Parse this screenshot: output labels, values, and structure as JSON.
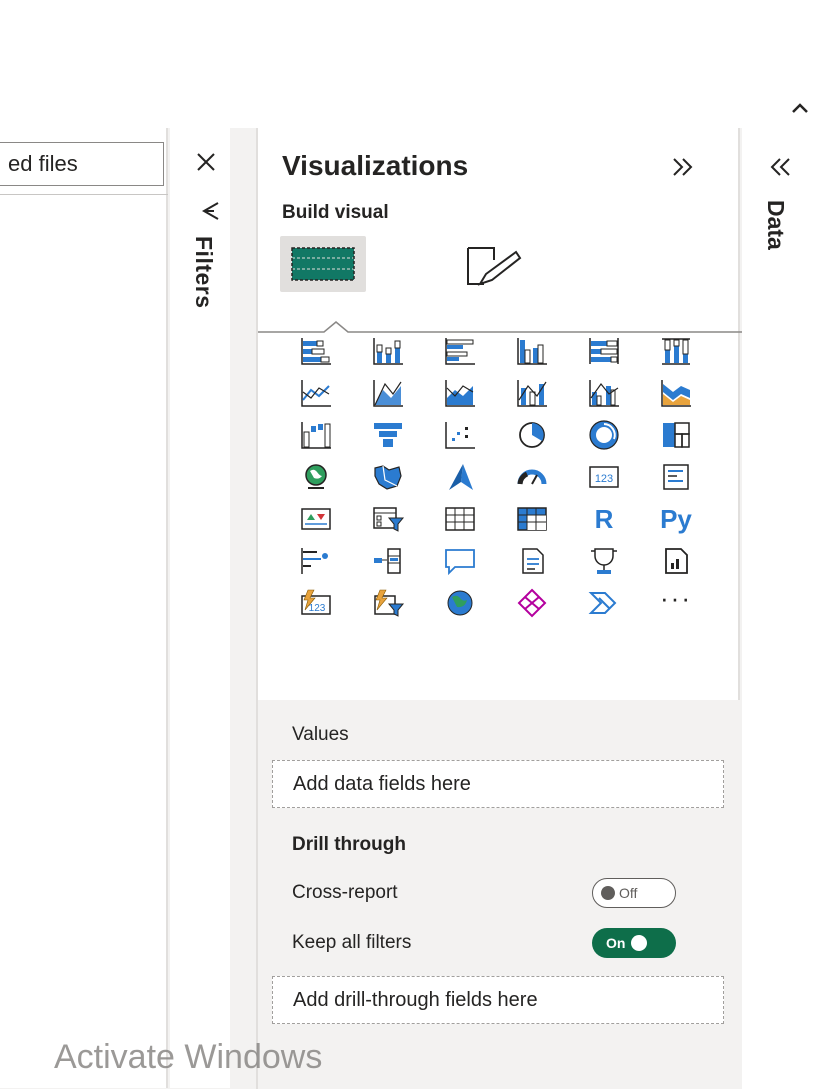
{
  "left": {
    "files_input_value": "ed files",
    "filters_label": "Filters"
  },
  "viz": {
    "title": "Visualizations",
    "build_label": "Build visual",
    "visual_icons": [
      "stacked-bar-chart-icon",
      "stacked-column-chart-icon",
      "clustered-bar-chart-icon",
      "clustered-column-chart-icon",
      "100-stacked-bar-chart-icon",
      "100-stacked-column-chart-icon",
      "line-chart-icon",
      "area-chart-icon",
      "stacked-area-chart-icon",
      "line-and-stacked-column-chart-icon",
      "line-and-clustered-column-chart-icon",
      "ribbon-chart-icon",
      "waterfall-chart-icon",
      "funnel-icon",
      "scatter-chart-icon",
      "pie-chart-icon",
      "donut-chart-icon",
      "treemap-icon",
      "map-icon",
      "filled-map-icon",
      "azure-map-icon",
      "gauge-icon",
      "card-icon",
      "multi-row-card-icon",
      "kpi-icon",
      "slicer-icon",
      "table-icon",
      "matrix-icon",
      "r-script-visual-icon",
      "python-visual-icon",
      "key-influencers-icon",
      "decomposition-tree-icon",
      "q-and-a-icon",
      "smart-narrative-icon",
      "metrics-icon",
      "paginated-report-icon",
      "power-apps-card-icon",
      "power-apps-slicer-icon",
      "arcgis-map-icon",
      "power-apps-icon",
      "power-automate-icon",
      "more-visuals-icon"
    ],
    "r_text": "R",
    "py_text": "Py",
    "more_text": "···",
    "values_label": "Values",
    "values_drop": "Add data fields here",
    "drill_label": "Drill through",
    "cross_report_label": "Cross-report",
    "cross_report_state": "Off",
    "keep_filters_label": "Keep all filters",
    "keep_filters_state": "On",
    "drill_drop": "Add drill-through fields here"
  },
  "data_pane": {
    "label": "Data"
  },
  "watermark": "Activate Windows",
  "colors": {
    "accent_green": "#0e6e4a",
    "visual_blue": "#2b7bd0",
    "pane_gray": "#f3f2f1"
  }
}
